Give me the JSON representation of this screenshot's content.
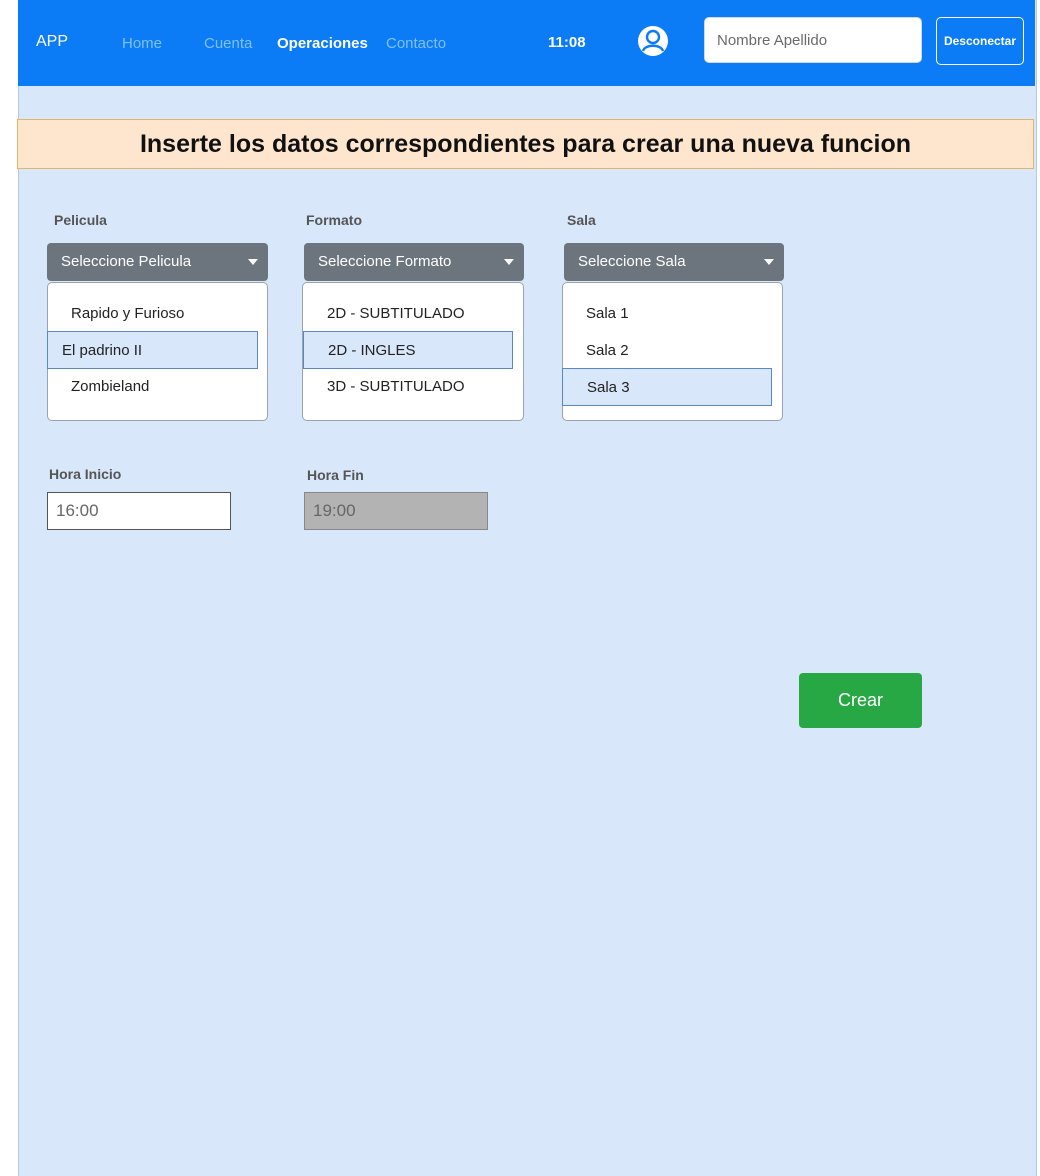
{
  "navbar": {
    "brand": "APP",
    "links": [
      {
        "label": "Home",
        "active": false
      },
      {
        "label": "Cuenta",
        "active": false
      },
      {
        "label": "Operaciones",
        "active": true
      },
      {
        "label": "Contacto",
        "active": false
      }
    ],
    "clock": "11:08",
    "user_icon": "user-circle-icon",
    "name_placeholder": "Nombre Apellido",
    "logout_label": "Desconectar"
  },
  "banner": {
    "text": "Inserte los datos correspondientes para crear una nueva funcion"
  },
  "form": {
    "pelicula": {
      "label": "Pelicula",
      "button": "Seleccione Pelicula",
      "options": [
        "Rapido y Furioso",
        "El padrino II",
        "Zombieland"
      ],
      "selected": "El padrino II"
    },
    "formato": {
      "label": "Formato",
      "button": "Seleccione Formato",
      "options": [
        "2D - SUBTITULADO",
        "2D - INGLES",
        "3D - SUBTITULADO"
      ],
      "selected": "2D - INGLES"
    },
    "sala": {
      "label": "Sala",
      "button": "Seleccione Sala",
      "options": [
        "Sala 1",
        "Sala 2",
        "Sala 3"
      ],
      "selected": "Sala 3"
    },
    "hora_inicio": {
      "label": "Hora Inicio",
      "value": "16:00"
    },
    "hora_fin": {
      "label": "Hora Fin",
      "value": "19:00",
      "disabled": true
    },
    "create_label": "Crear"
  },
  "colors": {
    "navbar": "#0b7cf5",
    "page_bg": "#d9e7fa",
    "banner_bg": "#fde6cd",
    "dropdown": "#6c757d",
    "create_button": "#28a745"
  }
}
